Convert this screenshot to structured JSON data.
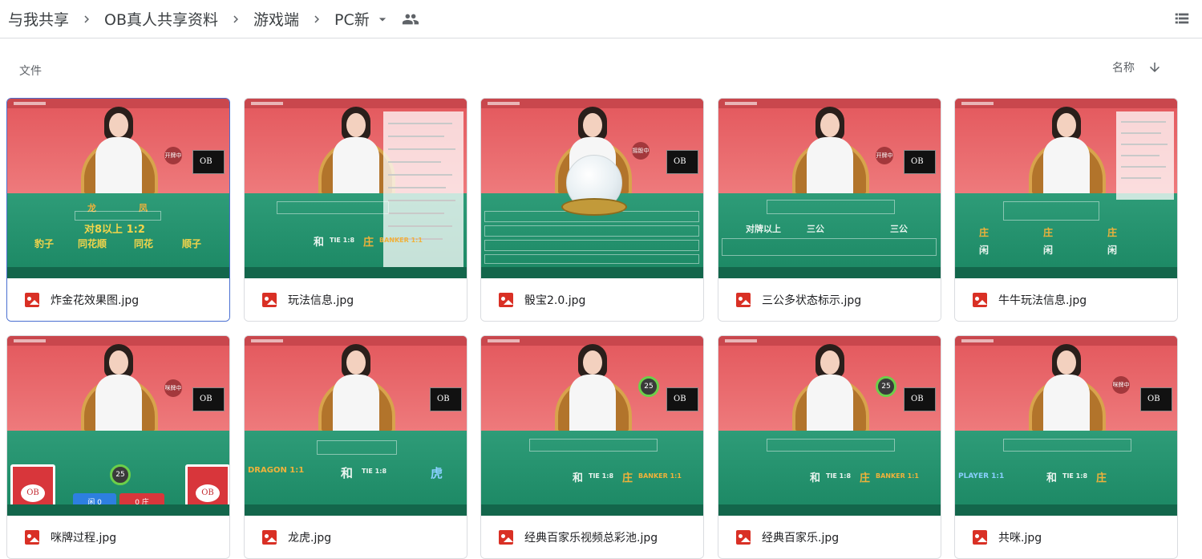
{
  "breadcrumbs": [
    {
      "label": "与我共享"
    },
    {
      "label": "OB真人共享资料"
    },
    {
      "label": "游戏端"
    },
    {
      "label": "PC新"
    }
  ],
  "icons": {
    "separator": "chevron-right-icon",
    "dropdown": "arrow-drop-down-icon",
    "shared": "people-icon",
    "view": "list-view-icon",
    "sort_direction": "arrow-downward-icon",
    "file_type": "image-file-icon"
  },
  "section_label": "文件",
  "sort": {
    "label": "名称"
  },
  "files": [
    {
      "name": "炸金花效果图.jpg",
      "selected": true
    },
    {
      "name": "玩法信息.jpg",
      "selected": false
    },
    {
      "name": "骰宝2.0.jpg",
      "selected": false
    },
    {
      "name": "三公多状态标示.jpg",
      "selected": false
    },
    {
      "name": "牛牛玩法信息.jpg",
      "selected": false
    },
    {
      "name": "咪牌过程.jpg",
      "selected": false
    },
    {
      "name": "龙虎.jpg",
      "selected": false
    },
    {
      "name": "经典百家乐视频总彩池.jpg",
      "selected": false
    },
    {
      "name": "经典百家乐.jpg",
      "selected": false
    },
    {
      "name": "共咪.jpg",
      "selected": false
    }
  ],
  "thumbnail_text": {
    "zjh_odds": "对8以上 1:2",
    "zjh_baozi": "豹子",
    "zjh_tonghuashun": "同花顺",
    "zjh_tonghua": "同花",
    "zjh_shunzi": "顺子",
    "zjh_long": "龙",
    "zjh_feng": "凤",
    "wf_he": "和",
    "wf_tie": "TIE 1:8",
    "wf_zhuang": "庄",
    "wf_banker": "BANKER 1:1",
    "sg_sangong": "三公",
    "sg_duipai": "对牌以上",
    "nn_zhuang": "庄",
    "nn_xian": "闲",
    "mp_timer": "25",
    "lh_he": "和",
    "lh_tie": "TIE 1:8",
    "lh_hu": "虎",
    "lh_dragon": "DRAGON 1:1",
    "bjl_timer": "25",
    "bjl_he": "和",
    "bjl_tie": "TIE 1:8",
    "bjl_zhuang": "庄",
    "bjl_banker": "BANKER 1:1",
    "gm_he": "和",
    "gm_tie": "TIE 1:8",
    "gm_zhuang": "庄",
    "gm_player": "PLAYER 1:1"
  },
  "colors": {
    "accent_selected": "#4a6fd1",
    "file_icon": "#d93025",
    "felt": "#1b8763",
    "wall": "#e3575c"
  }
}
